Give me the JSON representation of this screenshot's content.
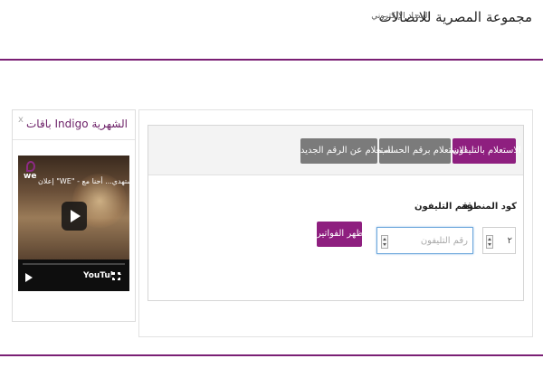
{
  "header": {
    "title": "مجموعة المصرية للاتصالات",
    "subtitle": "السداد الإلكتروني"
  },
  "sidebar": {
    "title": "باقات Indigo الشهرية",
    "close_label": "x",
    "video": {
      "brand": "we",
      "caption": "إعلان \"WE\" - استهدي... أحنا مع",
      "player": "YouTube"
    }
  },
  "tabs": [
    {
      "label": "الاستعلام بالتليفون",
      "active": true
    },
    {
      "label": "الاستعلام برقم الحساب",
      "active": false
    },
    {
      "label": "استعلام عن الرقم الجديد",
      "active": false
    }
  ],
  "form": {
    "area_code_label": "كود المنطقة",
    "phone_label": "رقم التليفون",
    "area_code_value": "٢",
    "phone_placeholder": "رقم التليفون",
    "submit_label": "اظهر الفواتير"
  },
  "colors": {
    "accent": "#8e1f7f",
    "inactive_tab": "#7b7b7b",
    "rule": "#7a1f74"
  },
  "icons": [
    "close-icon",
    "play-icon",
    "we-logo-icon",
    "youtube-logo",
    "fullscreen-icon",
    "spinner-icon"
  ]
}
